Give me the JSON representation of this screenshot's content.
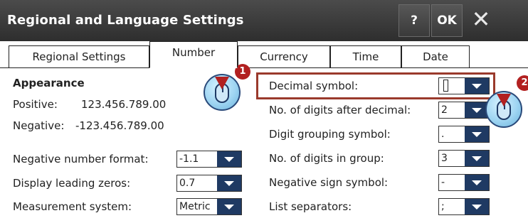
{
  "window": {
    "title": "Regional and Language Settings",
    "help_label": "?",
    "ok_label": "OK",
    "close_glyph": "✕"
  },
  "tabs": [
    {
      "label": "Regional Settings",
      "active": false
    },
    {
      "label": "Number",
      "active": true
    },
    {
      "label": "Currency",
      "active": false
    },
    {
      "label": "Time",
      "active": false
    },
    {
      "label": "Date",
      "active": false
    }
  ],
  "appearance": {
    "heading": "Appearance",
    "positive_label": "Positive:",
    "positive_value": "123.456.789.00",
    "negative_label": "Negative:",
    "negative_value": "-123.456.789.00"
  },
  "left_fields": [
    {
      "label": "Negative number format:",
      "value": "-1.1"
    },
    {
      "label": "Display leading zeros:",
      "value": "0.7"
    },
    {
      "label": "Measurement system:",
      "value": "Metric"
    }
  ],
  "right_fields": [
    {
      "label": "Decimal symbol:",
      "value": ""
    },
    {
      "label": "No. of digits after decimal:",
      "value": "2"
    },
    {
      "label": "Digit grouping symbol:",
      "value": "."
    },
    {
      "label": "No. of digits in group:",
      "value": "3"
    },
    {
      "label": "Negative sign symbol:",
      "value": "-"
    },
    {
      "label": "List separators:",
      "value": ";"
    }
  ],
  "callouts": [
    {
      "number": "1"
    },
    {
      "number": "2"
    }
  ],
  "colors": {
    "titlebar": "#3a3a3a",
    "dropdown_arrow": "#1f3a63",
    "highlight": "#9a3a2c",
    "badge": "#b22020"
  }
}
